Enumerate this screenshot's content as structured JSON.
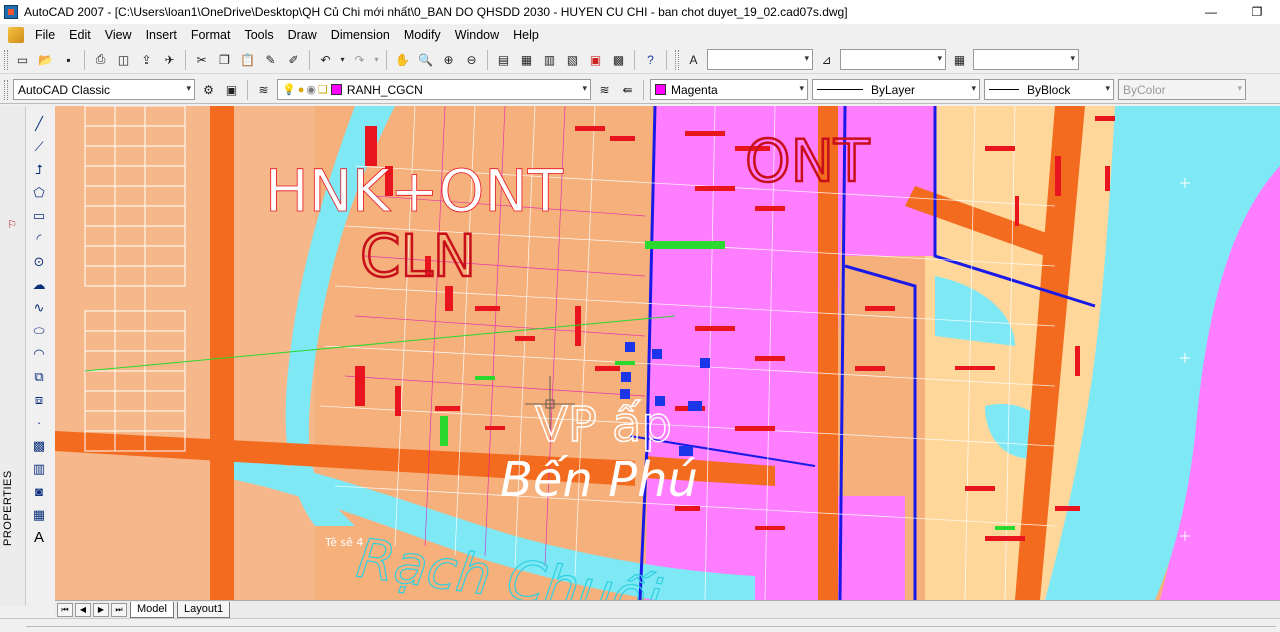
{
  "window": {
    "title": "AutoCAD 2007 - [C:\\Users\\loan1\\OneDrive\\Desktop\\QH Củ Chi mới nhất\\0_BAN DO QHSDD 2030 - HUYEN CU CHI - ban chot duyet_19_02.cad07s.dwg]",
    "minimize": "—",
    "restore": "❐"
  },
  "menu": [
    "File",
    "Edit",
    "View",
    "Insert",
    "Format",
    "Tools",
    "Draw",
    "Dimension",
    "Modify",
    "Window",
    "Help"
  ],
  "toolbar2": {
    "workspace": "AutoCAD Classic",
    "layer": "RANH_CGCN",
    "color": "Magenta",
    "linetype": "ByLayer",
    "lineweight": "ByBlock",
    "plotstyle": "ByColor"
  },
  "colors": {
    "layer_swatch": "#ff00ff",
    "color_swatch": "#ff00ff",
    "canvas_base": "#f5b07c",
    "river": "#7fe8f5",
    "residential": "#ff80ff",
    "road": "#f26b1f"
  },
  "palette": {
    "label": "PROPERTIES"
  },
  "drawing": {
    "labels": {
      "zone1": "HNK+ONT",
      "zone2": "CLN",
      "zone3": "ONT",
      "zone4": "VP ấp",
      "zone5": "Bến Phú",
      "zone6": "Rạch Chuối",
      "small1": "Tê sê 4"
    }
  },
  "layout": {
    "tabs": [
      "Model",
      "Layout1"
    ],
    "active": "Model"
  },
  "icons": {
    "draw_tools": [
      "line-icon",
      "construction-line-icon",
      "polyline-icon",
      "polygon-icon",
      "rectangle-icon",
      "arc-icon",
      "circle-icon",
      "revision-cloud-icon",
      "spline-icon",
      "ellipse-icon",
      "ellipse-arc-icon",
      "insert-block-icon",
      "make-block-icon",
      "point-icon",
      "hatch-icon",
      "gradient-icon",
      "region-icon",
      "table-icon",
      "multiline-text-icon"
    ]
  }
}
